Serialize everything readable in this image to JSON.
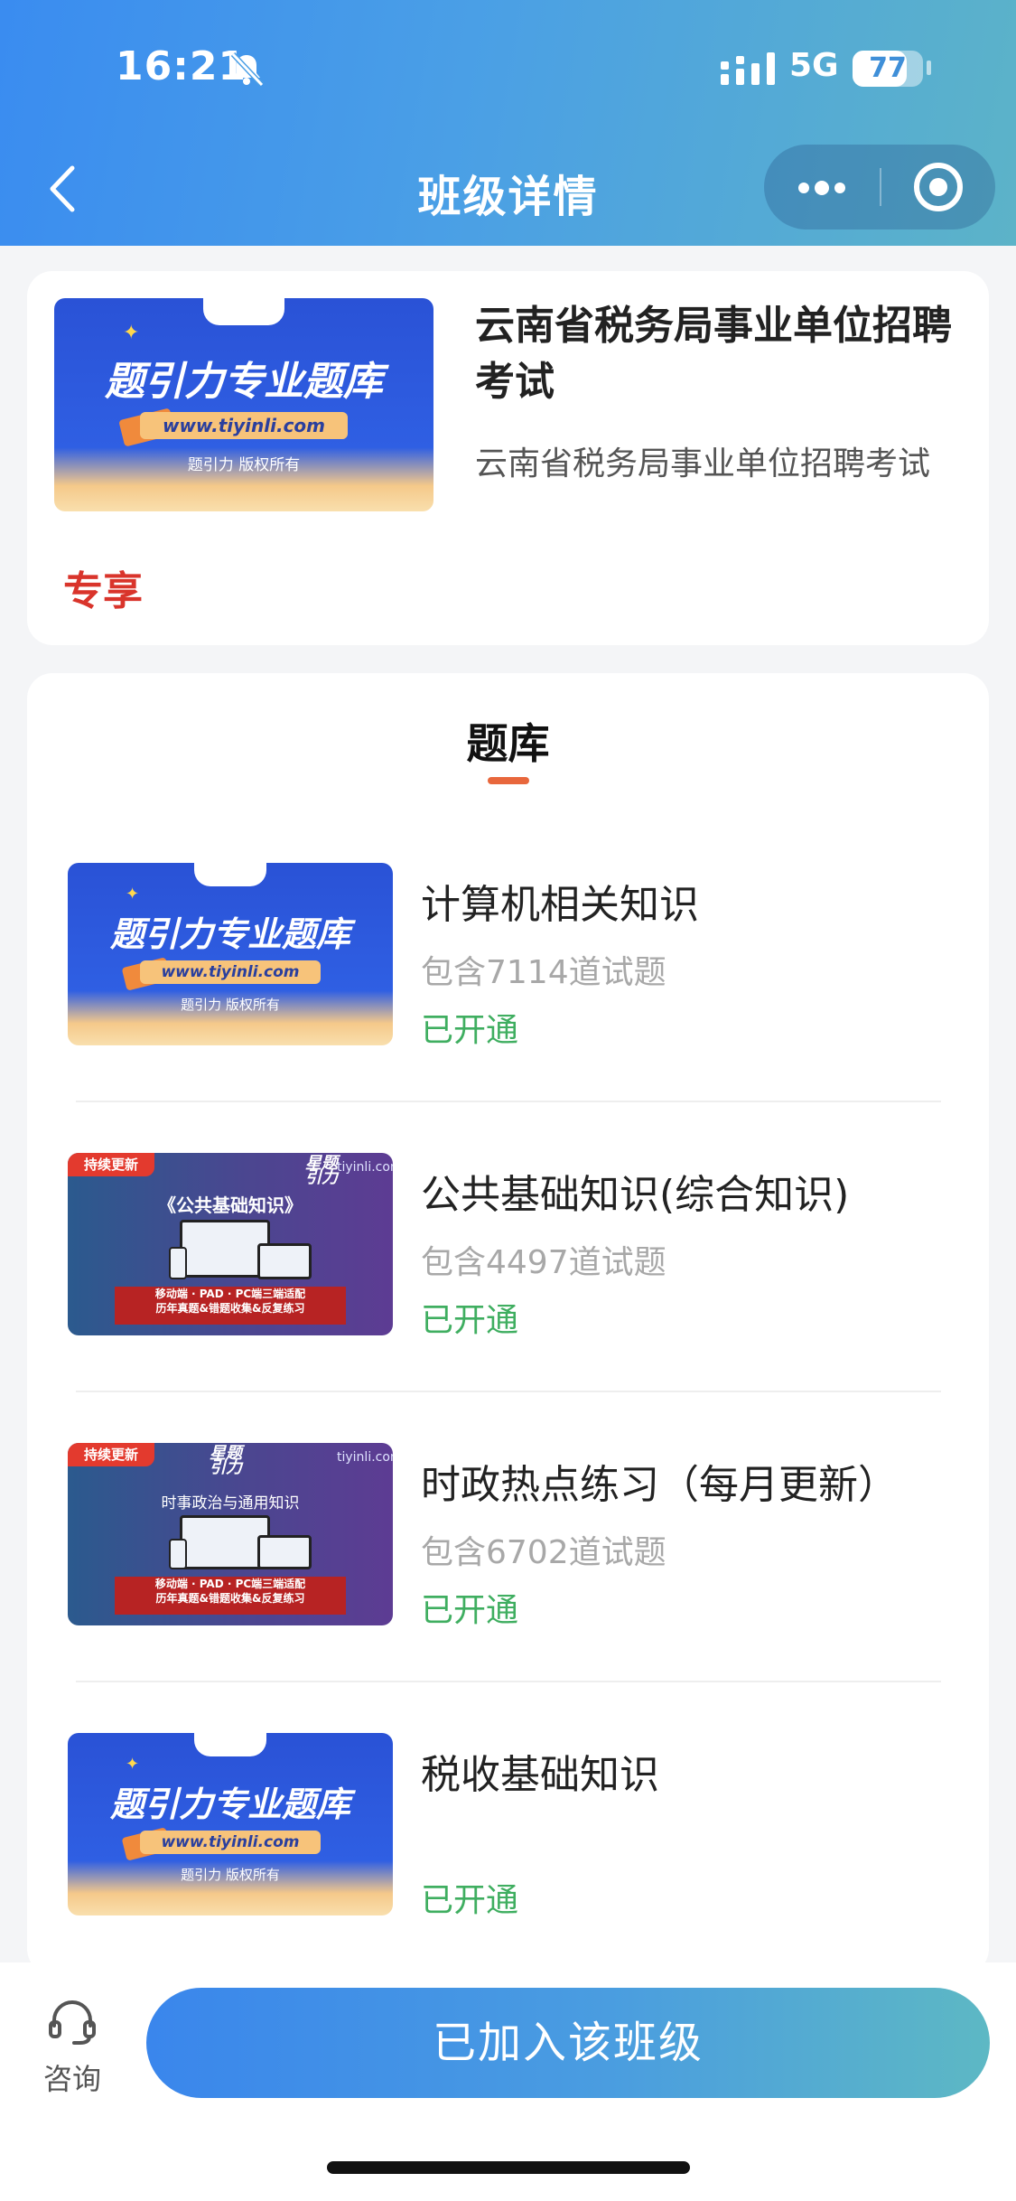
{
  "status_bar": {
    "time": "16:21",
    "network": "5G",
    "battery": "77",
    "battery_level": 0.77
  },
  "nav": {
    "title": "班级详情",
    "back_icon": "chevron-left-icon",
    "more_icon": "more-dots-icon",
    "close_icon": "target-circle-icon"
  },
  "class_info": {
    "title": "云南省税务局事业单位招聘考试",
    "subtitle": "云南省税务局事业单位招聘考试",
    "tag": "专享",
    "banner": {
      "title": "题引力专业题库",
      "url": "www.tiyinli.com",
      "copyright": "题引力 版权所有",
      "brand": "题引力"
    }
  },
  "bank": {
    "heading": "题库",
    "items": [
      {
        "name": "计算机相关知识",
        "count": "包含7114道试题",
        "status": "已开通",
        "banner": {
          "style": "blue",
          "title": "题引力专业题库",
          "url": "www.tiyinli.com",
          "copyright": "题引力 版权所有",
          "brand": "题引力"
        }
      },
      {
        "name": "公共基础知识(综合知识)",
        "count": "包含4497道试题",
        "status": "已开通",
        "banner": {
          "style": "purple",
          "badge": "持续更新",
          "site": "tiyinli.com",
          "logo": "星题引力",
          "heading": "《公共基础知识》",
          "ribbon1": "移动端 · PAD · PC端三端适配",
          "ribbon2": "历年真题&错题收集&反复练习"
        }
      },
      {
        "name": "时政热点练习（每月更新）",
        "count": "包含6702道试题",
        "status": "已开通",
        "banner": {
          "style": "purple",
          "badge": "持续更新",
          "site": "tiyinli.com",
          "logo": "星题引力",
          "heading": "时事政治与通用知识",
          "ribbon1": "移动端 · PAD · PC端三端适配",
          "ribbon2": "历年真题&错题收集&反复练习"
        }
      },
      {
        "name": "税收基础知识",
        "count": "",
        "status": "已开通",
        "banner": {
          "style": "blue",
          "title": "题引力专业题库",
          "url": "www.tiyinli.com",
          "copyright": "题引力 版权所有",
          "brand": "题引力"
        }
      }
    ]
  },
  "bottom": {
    "consult_label": "咨询",
    "consult_icon": "headset-icon",
    "join_label": "已加入该班级"
  }
}
